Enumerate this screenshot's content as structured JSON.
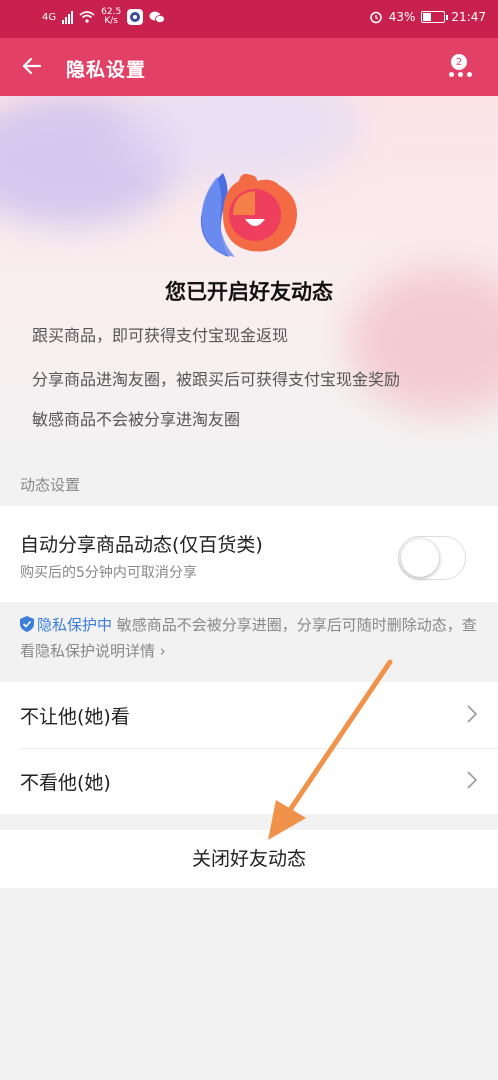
{
  "status_bar": {
    "network": "4G",
    "speed_value": "62.5",
    "speed_unit": "K/s",
    "battery": "43%",
    "battery_level": 0.43,
    "time": "21:47"
  },
  "header": {
    "title": "隐私设置",
    "badge_count": "2",
    "back_icon": "back-arrow-icon",
    "more_icon": "more-dots-icon"
  },
  "hero": {
    "title": "您已开启好友动态",
    "lines": [
      "跟买商品，即可获得支付宝现金返现",
      "分享商品进淘友圈，被跟买后可获得支付宝现金奖励",
      "敏感商品不会被分享进淘友圈"
    ]
  },
  "section_label": "动态设置",
  "auto_share": {
    "title": "自动分享商品动态(仅百货类)",
    "subtitle": "购买后的5分钟内可取消分享",
    "enabled": false
  },
  "privacy_note": {
    "highlight": "隐私保护中",
    "text": "敏感商品不会被分享进圈，分享后可随时删除动态，查看隐私保护说明详情",
    "chevron": "›"
  },
  "rows": [
    {
      "label": "不让他(她)看"
    },
    {
      "label": "不看他(她)"
    }
  ],
  "close_button": "关闭好友动态",
  "colors": {
    "status_bar": "#c8214d",
    "app_bar": "#e24067",
    "link_blue": "#3d7edb",
    "annotation_arrow": "#f0924a"
  }
}
